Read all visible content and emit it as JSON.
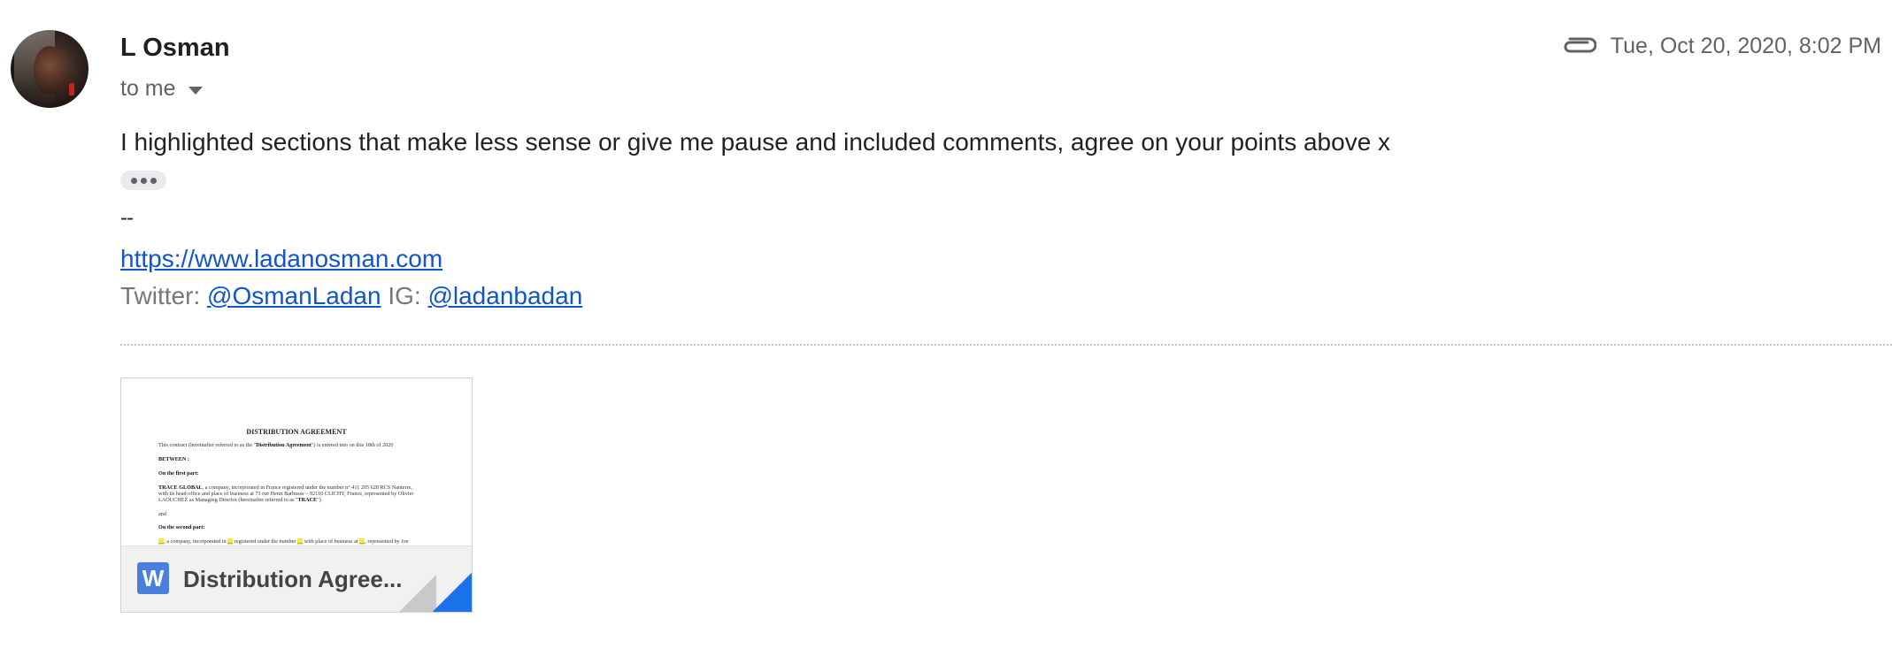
{
  "sender": {
    "name": "L Osman",
    "recipient_label": "to me"
  },
  "meta": {
    "attachment_icon": "paperclip-icon",
    "timestamp": "Tue, Oct 20, 2020, 8:02 PM"
  },
  "message": {
    "body": "I highlighted sections that make less sense or give me pause and included comments, agree on your points above x",
    "signature_separator": "--",
    "website": "https://www.ladanosman.com",
    "twitter_label": "Twitter: ",
    "twitter_handle": "@OsmanLadan",
    "ig_label": " IG: ",
    "ig_handle": "@ladanbadan"
  },
  "attachment": {
    "name": "Distribution Agree...",
    "type_letter": "W",
    "preview": {
      "title": "DISTRIBUTION AGREEMENT",
      "line1_a": "This contract (hereinafter referred to as the \"",
      "line1_b": "Distribution Agreement",
      "line1_c": "\") is entered into on this 18th of 2020",
      "between": "BETWEEN :",
      "first_part": "On the first part:",
      "company_name": "TRACE GLOBAL",
      "company_a": ", a company, incorporated in France registered under the number n° 411 205 628 RCS Nanterre,",
      "company_b": "with its head office and place of business at 73 rue Henri Barbusse – 92110 CLICHY, France, represented by Olivier",
      "company_c_a": "LAOUCHEZ as Managing Director (hereinafter referred to as \"",
      "company_c_b": "TRACE",
      "company_c_c": "\")",
      "and": "and",
      "second_part": "On the second part:",
      "second_a": ", a company, incorporated in ",
      "second_b": " registered under the number ",
      "second_c": " with place of business at ",
      "second_d": ", represented by Joe"
    }
  },
  "colors": {
    "link": "#1155cc",
    "word_icon": "#4a7fe0",
    "corner_accent": "#1a73e8"
  }
}
